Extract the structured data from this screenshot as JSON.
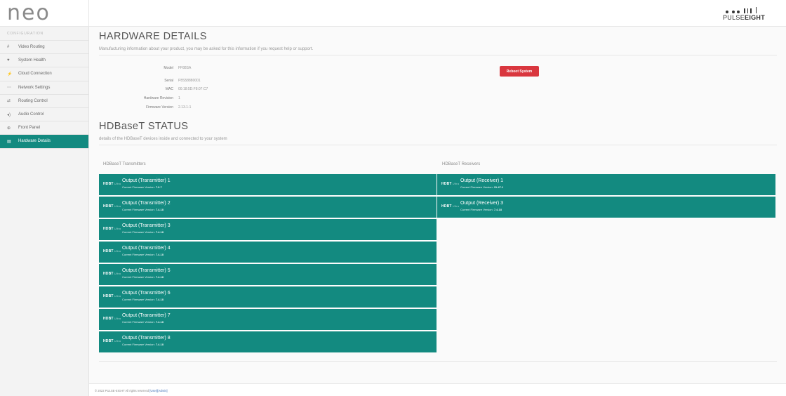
{
  "header": {
    "logo": "neo",
    "brand": {
      "light": "PULSE",
      "bold": "EIGHT"
    }
  },
  "sidebar": {
    "heading": "CONFIGURATION",
    "items": [
      {
        "icon": "#",
        "icon_name": "hash-icon",
        "label": "Video Routing",
        "active": false
      },
      {
        "icon": "♥",
        "icon_name": "heart-icon",
        "label": "System Health",
        "active": false
      },
      {
        "icon": "⚡",
        "icon_name": "cloud-connection-icon",
        "label": "Cloud Connection",
        "active": false
      },
      {
        "icon": "⋯",
        "icon_name": "network-icon",
        "label": "Network Settings",
        "active": false
      },
      {
        "icon": "⇄",
        "icon_name": "routing-control-icon",
        "label": "Routing Control",
        "active": false
      },
      {
        "icon": "◂)",
        "icon_name": "speaker-icon",
        "label": "Audio Control",
        "active": false
      },
      {
        "icon": "⊕",
        "icon_name": "front-panel-icon",
        "label": "Front Panel",
        "active": false
      },
      {
        "icon": "▤",
        "icon_name": "hardware-icon",
        "label": "Hardware Details",
        "active": true
      }
    ]
  },
  "hardware": {
    "title": "HARDWARE DETAILS",
    "description": "Manufacturing information about your product, you may be asked for this information if you request help or support.",
    "rows": [
      {
        "key": "Model",
        "value": "FF88SA"
      },
      {
        "key": "Serial",
        "value": "P8S58880001"
      },
      {
        "key": "MAC",
        "value": "00:18:5D:F8:07:C7"
      },
      {
        "key": "Hardware Revision",
        "value": "1"
      },
      {
        "key": "Firmware Version",
        "value": "2.13.1-1"
      }
    ],
    "reboot_label": "Reboot System"
  },
  "hdbaset": {
    "title": "HDBaseT STATUS",
    "description": "details of the HDBaseT devices inside and connected to your system",
    "logo_text": "HDBT",
    "logo_suffix": "Ultra",
    "fw_prefix": "Current Firmware Version:",
    "transmitters_label": "HDBaseT Transmitters",
    "receivers_label": "HDBaseT Receivers",
    "transmitters": [
      {
        "name": "Output (Transmitter) 1",
        "firmware": "7.0.7"
      },
      {
        "name": "Output (Transmitter) 2",
        "firmware": "7.4.18"
      },
      {
        "name": "Output (Transmitter) 3",
        "firmware": "7.4.18"
      },
      {
        "name": "Output (Transmitter) 4",
        "firmware": "7.4.18"
      },
      {
        "name": "Output (Transmitter) 5",
        "firmware": "7.4.18"
      },
      {
        "name": "Output (Transmitter) 6",
        "firmware": "7.4.18"
      },
      {
        "name": "Output (Transmitter) 7",
        "firmware": "7.4.18"
      },
      {
        "name": "Output (Transmitter) 8",
        "firmware": "7.4.18"
      }
    ],
    "receivers": [
      {
        "name": "Output (Receiver) 1",
        "firmware": "31.47.1"
      },
      {
        "name": "Output (Receiver) 3",
        "firmware": "7.4.18"
      }
    ]
  },
  "footer": {
    "text": "© 2022 PULSE-EIGHT All rights reserved",
    "user_link": "[User]",
    "admin_link": "[Admin]"
  },
  "colors": {
    "accent": "#138a80",
    "danger": "#d9363e",
    "sidebar_bg": "#f3f3f3"
  }
}
